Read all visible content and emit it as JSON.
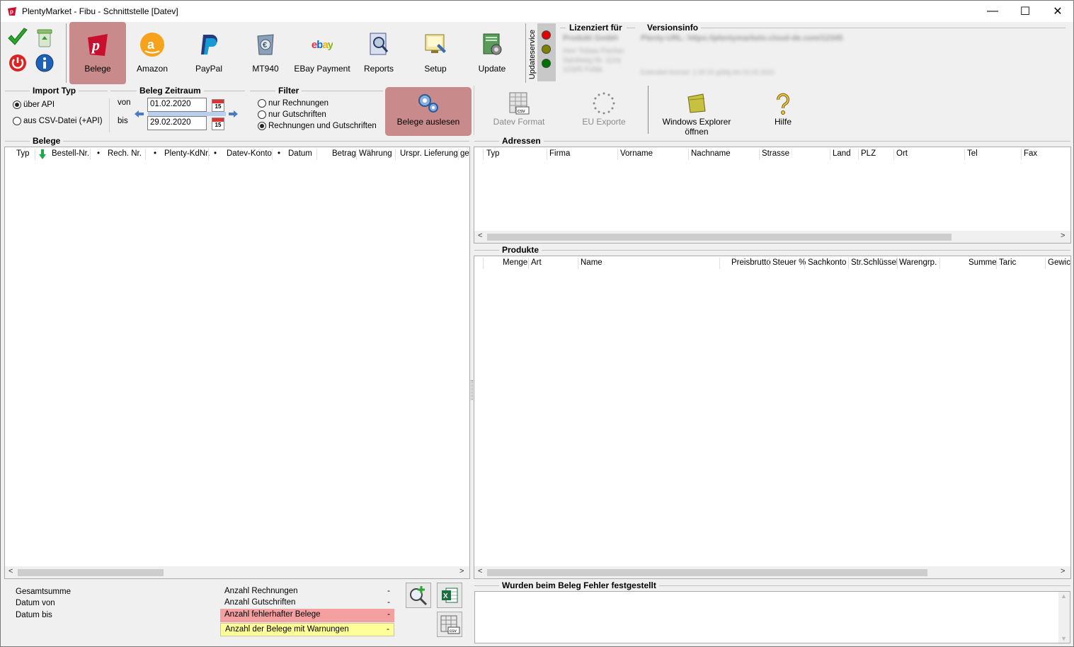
{
  "window": {
    "title": "PlentyMarket - Fibu - Schnittstelle [Datev]",
    "minimize_glyph": "—",
    "maximize_glyph": "☐",
    "close_glyph": "✕"
  },
  "toolbar": {
    "buttons": [
      {
        "label": "Belege",
        "icon": "plenty-icon"
      },
      {
        "label": "Amazon",
        "icon": "amazon-icon"
      },
      {
        "label": "PayPal",
        "icon": "paypal-icon"
      },
      {
        "label": "MT940",
        "icon": "mt940-icon"
      },
      {
        "label": "EBay Payment",
        "icon": "ebay-icon"
      },
      {
        "label": "Reports",
        "icon": "reports-icon"
      },
      {
        "label": "Setup",
        "icon": "setup-icon"
      },
      {
        "label": "Update",
        "icon": "update-icon"
      }
    ],
    "ebay_logo_text": "ebay"
  },
  "updateservice": {
    "label": "Updateservice",
    "lights": [
      "#e00000",
      "#808000",
      "#007000"
    ]
  },
  "license": {
    "title": "Lizenziert für",
    "lines": [
      "Produkt GmbH",
      "Herr Tobias Fischer",
      "Sandweg Nr. 112a",
      "12345 Fulda"
    ]
  },
  "versioninfo": {
    "title": "Versionsinfo",
    "line1": "Plenty-URL: https://plentymarkets.cloud-de.com/12345",
    "line2": "Extended license: 1.00.15 gültig bis 01.02.2021"
  },
  "import_typ": {
    "title": "Import Typ",
    "options": [
      {
        "label": "über API",
        "selected": true
      },
      {
        "label": "aus CSV-Datei (+API)",
        "selected": false
      }
    ]
  },
  "zeitraum": {
    "title": "Beleg Zeitraum",
    "von_label": "von",
    "bis_label": "bis",
    "von_value": "01.02.2020",
    "bis_value": "29.02.2020",
    "cal_day": "15"
  },
  "filter": {
    "title": "Filter",
    "options": [
      {
        "label": "nur Rechnungen",
        "selected": false
      },
      {
        "label": "nur Gutschriften",
        "selected": false
      },
      {
        "label": "Rechnungen und Gutschriften",
        "selected": true
      }
    ]
  },
  "actions": {
    "belege_auslesen": "Belege auslesen",
    "datev_format": "Datev Format",
    "eu_exporte": "EU Exporte",
    "explorer": "Windows Explorer öffnen",
    "hilfe": "Hilfe"
  },
  "belege": {
    "title": "Belege",
    "columns": [
      "Typ",
      "Bestell-Nr.",
      "Rech. Nr.",
      "Plenty-KdNr.",
      "Datev-Konto",
      "Datum",
      "Betrag",
      "Währung",
      "Urspr. Lieferung",
      "ge"
    ],
    "bullet": "•"
  },
  "adressen": {
    "title": "Adressen",
    "columns": [
      "Typ",
      "Firma",
      "Vorname",
      "Nachname",
      "Strasse",
      "Land",
      "PLZ",
      "Ort",
      "Tel",
      "Fax"
    ]
  },
  "produkte": {
    "title": "Produkte",
    "columns": [
      "Menge",
      "Art",
      "Name",
      "Preisbrutto",
      "Steuer %",
      "Sachkonto",
      "Str.Schlüssel",
      "Warengrp.",
      "Summe",
      "Taric",
      "Gewic"
    ]
  },
  "summary": {
    "gesamtsumme": "Gesamtsumme",
    "datum_von": "Datum von",
    "datum_bis": "Datum bis",
    "anzahl_rechnungen": "Anzahl Rechnungen",
    "anzahl_gutschriften": "Anzahl Gutschriften",
    "anzahl_fehlerhaft": "Anzahl fehlerhafter Belege",
    "anzahl_warnungen": "Anzahl der Belege mit Warnungen",
    "dash": "-"
  },
  "fehler": {
    "title": "Wurden beim Beleg Fehler festgestellt"
  },
  "colors": {
    "active_button": "#c88a8a",
    "error_row": "#f4a0a0",
    "warning_row": "#ffff99"
  }
}
